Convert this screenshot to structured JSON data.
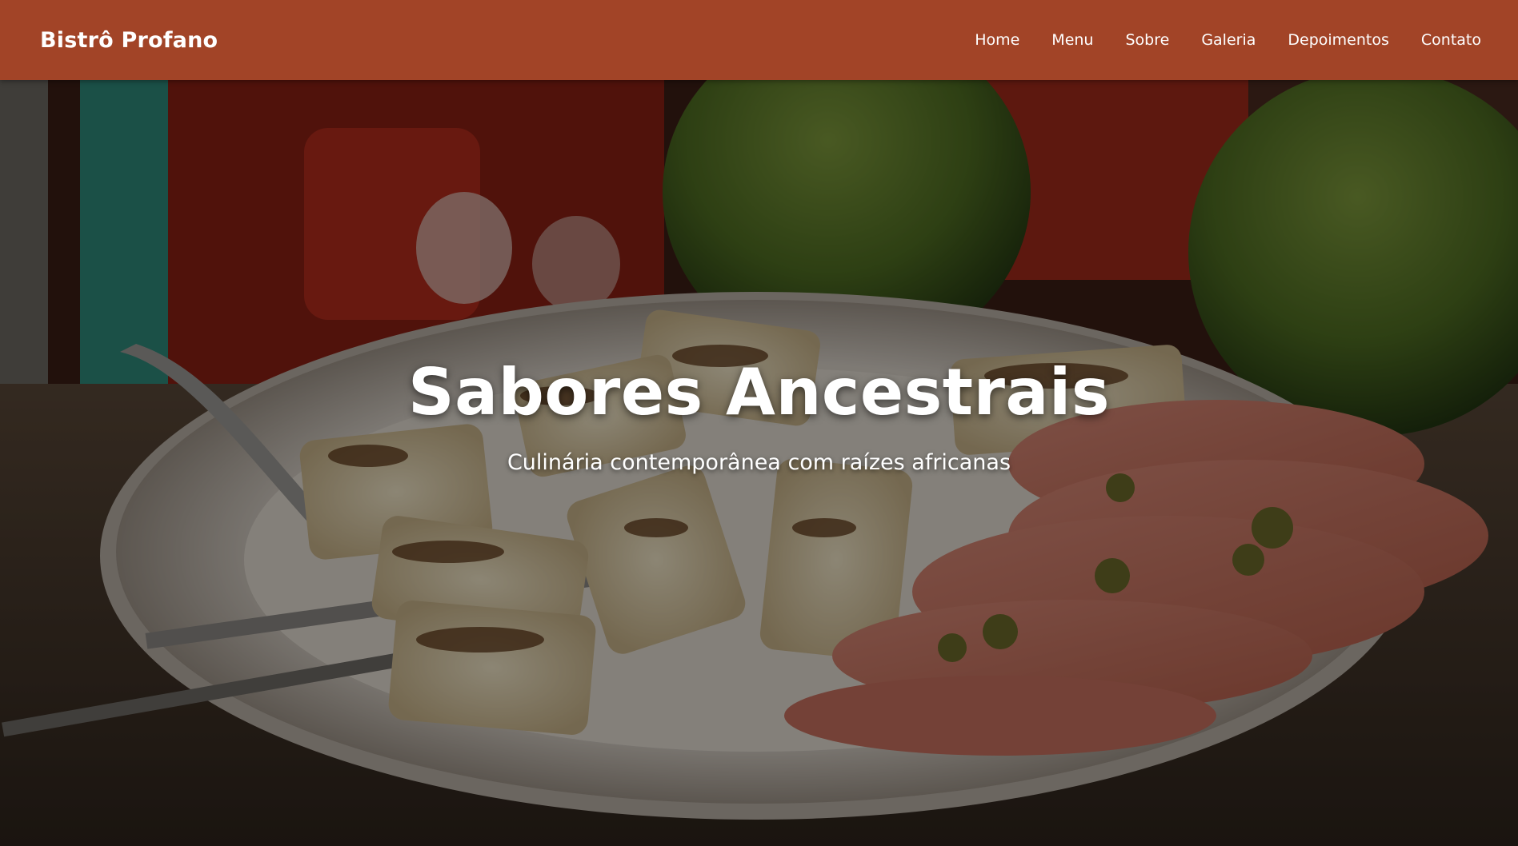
{
  "navbar": {
    "brand": "Bistrô Profano",
    "links": [
      {
        "label": "Home"
      },
      {
        "label": "Menu"
      },
      {
        "label": "Sobre"
      },
      {
        "label": "Galeria"
      },
      {
        "label": "Depoimentos"
      },
      {
        "label": "Contato"
      }
    ]
  },
  "hero": {
    "title": "Sabores Ancestrais",
    "subtitle": "Culinária contemporânea com raízes africanas"
  },
  "colors": {
    "navbar_bg": "#a24427",
    "text": "#ffffff"
  }
}
